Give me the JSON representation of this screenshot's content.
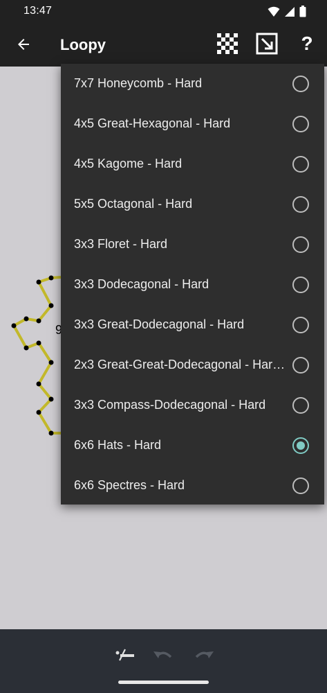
{
  "status_bar": {
    "time": "13:47"
  },
  "app_bar": {
    "title": "Loopy",
    "icons": [
      "back-arrow-icon",
      "checkerboard-icon",
      "resize-icon",
      "help-icon"
    ],
    "help_label": "?"
  },
  "board": {
    "clue": "9"
  },
  "menu": {
    "items": [
      {
        "label": "7x7 Honeycomb - Hard",
        "selected": false
      },
      {
        "label": "4x5 Great-Hexagonal - Hard",
        "selected": false
      },
      {
        "label": "4x5 Kagome - Hard",
        "selected": false
      },
      {
        "label": "5x5 Octagonal - Hard",
        "selected": false
      },
      {
        "label": "3x3 Floret - Hard",
        "selected": false
      },
      {
        "label": "3x3 Dodecagonal - Hard",
        "selected": false
      },
      {
        "label": "3x3 Great-Dodecagonal - Hard",
        "selected": false
      },
      {
        "label": "2x3 Great-Great-Dodecagonal - Har…",
        "selected": false
      },
      {
        "label": "3x3 Compass-Dodecagonal - Hard",
        "selected": false
      },
      {
        "label": "6x6 Hats - Hard",
        "selected": true
      },
      {
        "label": "6x6 Spectres - Hard",
        "selected": false
      }
    ]
  },
  "colors": {
    "accent": "#80cbc4",
    "loop_line": "#c2b82a",
    "board_bg": "#cfcdd1",
    "menu_bg": "#2e2e2e",
    "app_bar_bg": "#212121"
  },
  "bottom_bar": {
    "icons": [
      "line-tool-icon",
      "undo-icon",
      "redo-icon"
    ]
  }
}
